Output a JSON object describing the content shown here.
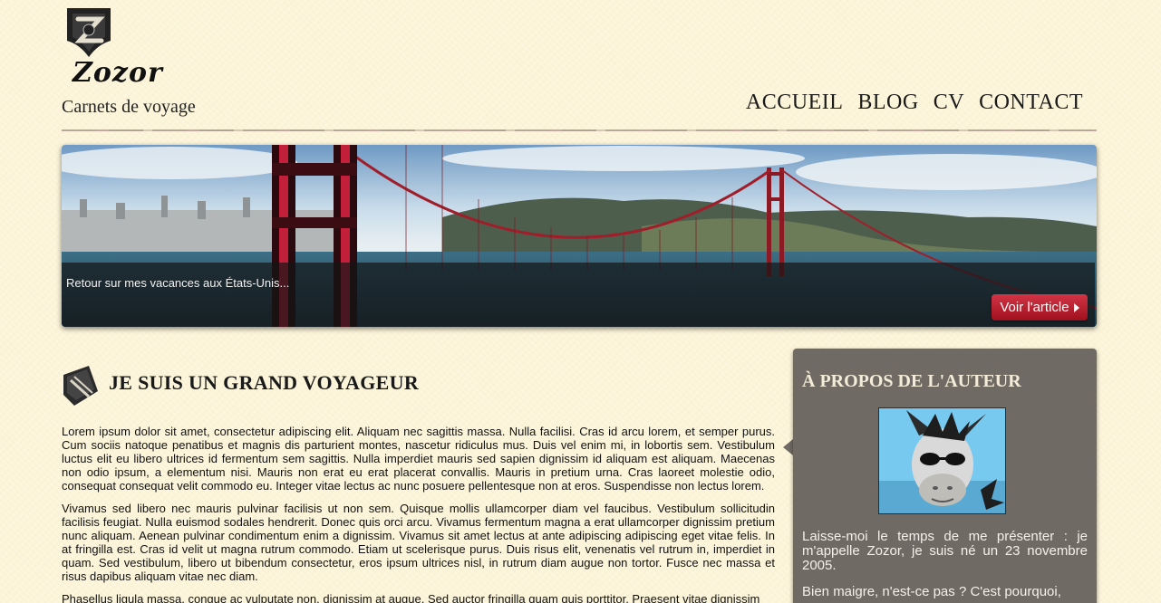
{
  "header": {
    "logo_text": "Zozor",
    "tagline": "Carnets de voyage",
    "nav": [
      "ACCUEIL",
      "BLOG",
      "CV",
      "CONTACT"
    ]
  },
  "banner": {
    "caption": "Retour sur mes vacances aux États-Unis...",
    "button_label": "Voir l'article",
    "image": "golden-gate-bridge-photo"
  },
  "article": {
    "title": "JE SUIS UN GRAND VOYAGEUR",
    "icon": "pen-nib-icon",
    "paragraphs": [
      "Lorem ipsum dolor sit amet, consectetur adipiscing elit. Aliquam nec sagittis massa. Nulla facilisi. Cras id arcu lorem, et semper purus. Cum sociis natoque penatibus et magnis dis parturient montes, nascetur ridiculus mus. Duis vel enim mi, in lobortis sem. Vestibulum luctus elit eu libero ultrices id fermentum sem sagittis. Nulla imperdiet mauris sed sapien dignissim id aliquam est aliquam. Maecenas non odio ipsum, a elementum nisi. Mauris non erat eu erat placerat convallis. Mauris in pretium urna. Cras laoreet molestie odio, consequat consequat velit commodo eu. Integer vitae lectus ac nunc posuere pellentesque non at eros. Suspendisse non lectus lorem.",
      "Vivamus sed libero nec mauris pulvinar facilisis ut non sem. Quisque mollis ullamcorper diam vel faucibus. Vestibulum sollicitudin facilisis feugiat. Nulla euismod sodales hendrerit. Donec quis orci arcu. Vivamus fermentum magna a erat ullamcorper dignissim pretium nunc aliquam. Aenean pulvinar condimentum enim a dignissim. Vivamus sit amet lectus at ante adipiscing adipiscing eget vitae felis. In at fringilla est. Cras id velit ut magna rutrum commodo. Etiam ut scelerisque purus. Duis risus elit, venenatis vel rutrum in, imperdiet in quam. Sed vestibulum, libero ut bibendum consectetur, eros ipsum ultrices nisl, in rutrum diam augue non tortor. Fusce nec massa et risus dapibus aliquam vitae nec diam.",
      "Phasellus ligula massa, congue ac vulputate non, dignissim at augue. Sed auctor fringilla quam quis porttitor. Praesent vitae dignissim"
    ]
  },
  "aside": {
    "title": "À PROPOS DE L'AUTEUR",
    "avatar": "zozor-donkey-avatar",
    "paragraphs": [
      "Laisse-moi le temps de me présenter : je m'appelle Zozor, je suis né un 23 novembre 2005.",
      "Bien maigre, n'est-ce pas ? C'est pourquoi,"
    ]
  },
  "colors": {
    "background": "#fdf6dc",
    "aside_bg": "#6f6a63",
    "button": "#c0202f"
  }
}
